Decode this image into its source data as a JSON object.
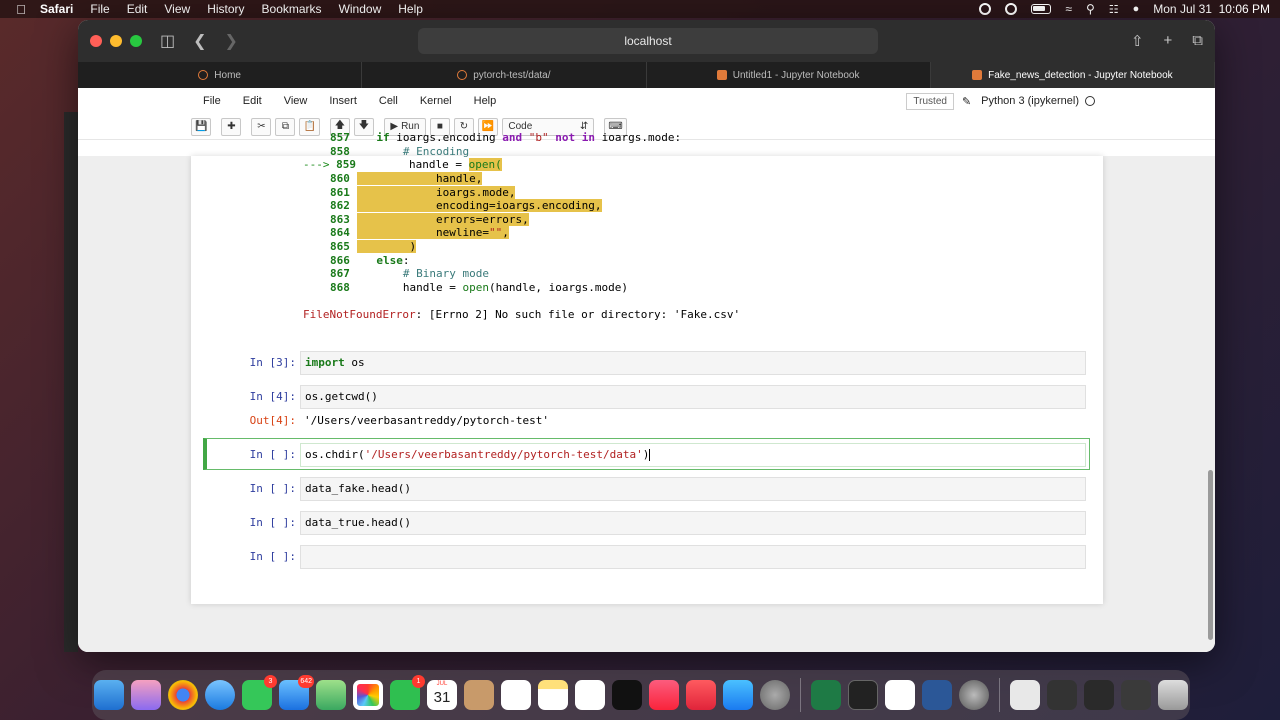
{
  "mac_menu": {
    "app": "Safari",
    "items": [
      "File",
      "Edit",
      "View",
      "History",
      "Bookmarks",
      "Window",
      "Help"
    ],
    "clock": "Mon Jul 31  10:06 PM"
  },
  "browser": {
    "address": "localhost",
    "tabs": [
      {
        "label": "Home"
      },
      {
        "label": "pytorch-test/data/"
      },
      {
        "label": "Untitled1 - Jupyter Notebook"
      },
      {
        "label": "Fake_news_detection - Jupyter Notebook"
      }
    ]
  },
  "jupyter": {
    "menu": [
      "File",
      "Edit",
      "View",
      "Insert",
      "Cell",
      "Kernel",
      "Help"
    ],
    "trusted": "Trusted",
    "kernel": "Python 3 (ipykernel)",
    "toolbar": {
      "run_label": "Run",
      "cell_type": "Code"
    }
  },
  "traceback": {
    "lines": [
      {
        "num": "857",
        "text": "    if ioargs.encoding and \"b\" not in ioargs.mode:"
      },
      {
        "num": "858",
        "text": "        # Encoding"
      },
      {
        "num": "859",
        "text": "        handle = open("
      },
      {
        "num": "860",
        "text": "            handle,"
      },
      {
        "num": "861",
        "text": "            ioargs.mode,"
      },
      {
        "num": "862",
        "text": "            encoding=ioargs.encoding,"
      },
      {
        "num": "863",
        "text": "            errors=errors,"
      },
      {
        "num": "864",
        "text": "            newline=\"\","
      },
      {
        "num": "865",
        "text": "        )"
      },
      {
        "num": "866",
        "text": "    else:"
      },
      {
        "num": "867",
        "text": "        # Binary mode"
      },
      {
        "num": "868",
        "text": "        handle = open(handle, ioargs.mode)"
      }
    ],
    "arrow": "--->",
    "error_name": "FileNotFoundError",
    "error_msg": ": [Errno 2] No such file or directory: 'Fake.csv'"
  },
  "cells": [
    {
      "prompt": "In [3]:",
      "code_kw": "import",
      "code_rest": " os"
    },
    {
      "prompt": "In [4]:",
      "code": "os.getcwd()",
      "out_prompt": "Out[4]:",
      "output": "'/Users/veerbasantreddy/pytorch-test'"
    },
    {
      "prompt": "In [ ]:",
      "code_fn": "os.chdir(",
      "code_str": "'/Users/veerbasantreddy/pytorch-test/data'",
      "code_end": ")"
    },
    {
      "prompt": "In [ ]:",
      "code": "data_fake.head()"
    },
    {
      "prompt": "In [ ]:",
      "code": "data_true.head()"
    },
    {
      "prompt": "In [ ]:",
      "code": ""
    }
  ],
  "dock": {
    "badges": {
      "settings": "3",
      "mail": "642",
      "facetime": "1"
    },
    "calendar_month": "JUL",
    "calendar_day": "31"
  }
}
